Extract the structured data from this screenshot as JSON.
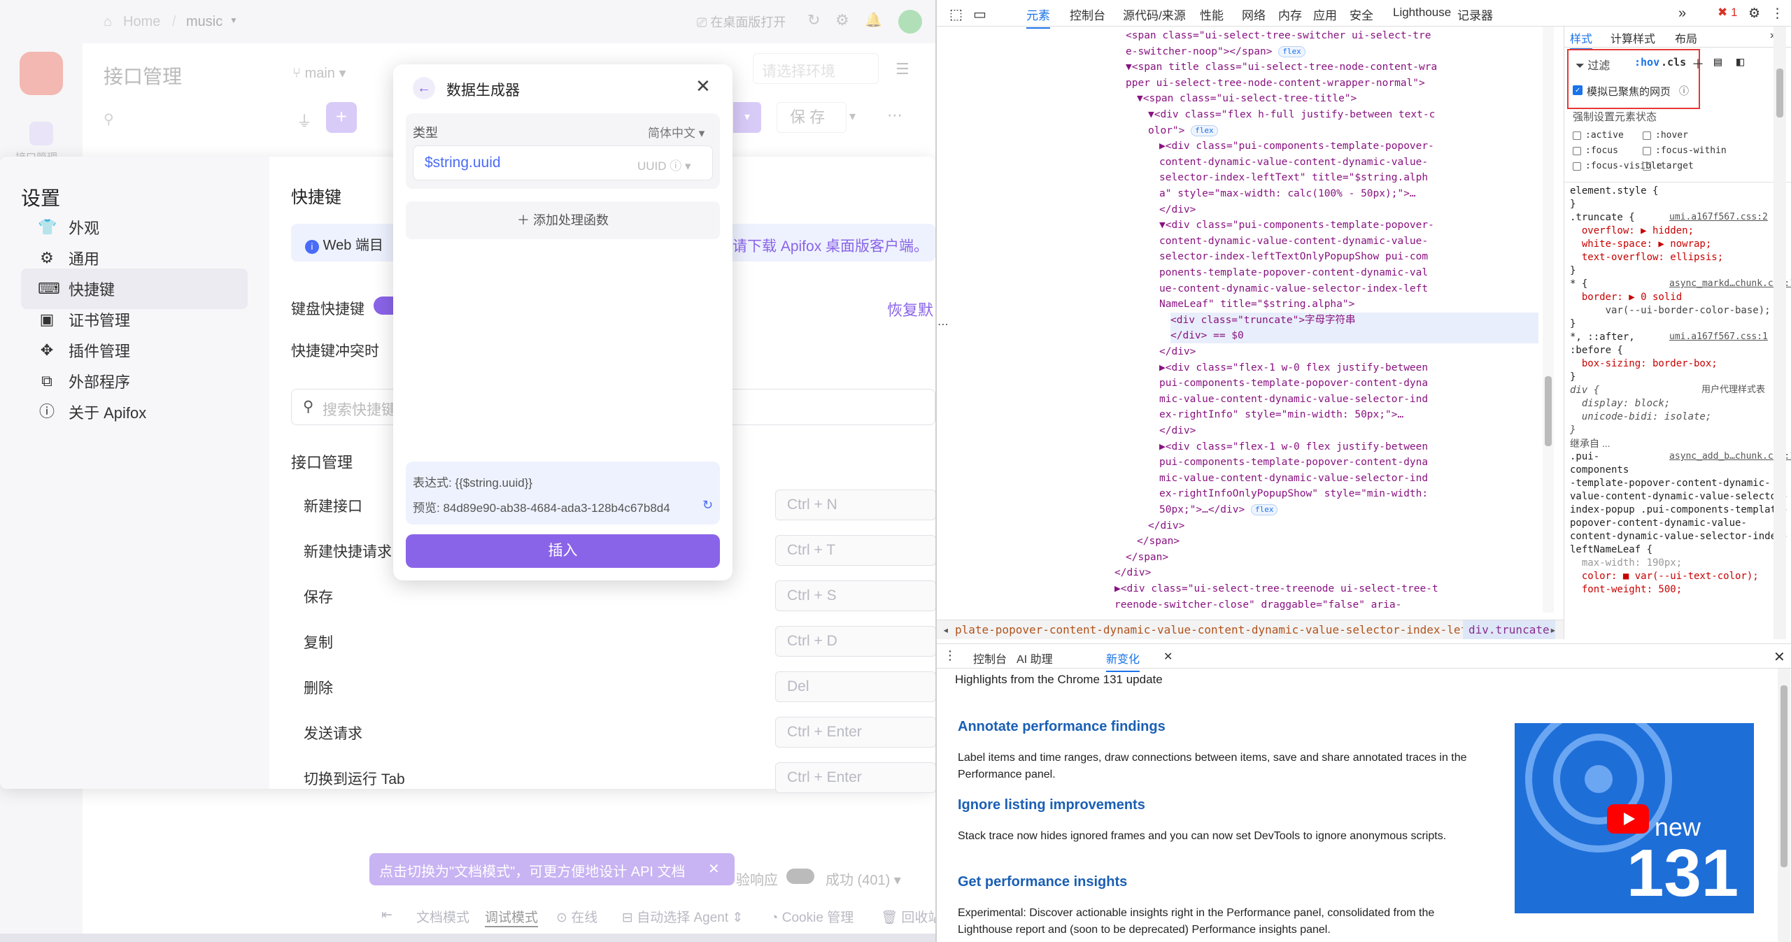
{
  "app": {
    "breadcrumb_home": "Home",
    "breadcrumb_project": "music",
    "open_web": "在桌面版打开",
    "page_title": "接口管理",
    "branch": "main",
    "env_placeholder": "请选择环境",
    "save_label": "保 存",
    "banner_text": "Web 端目",
    "banner_suffix": "请下载 Apifox 桌面版客户端。",
    "restore_label": "恢复默",
    "sidebar_label": "接口管理",
    "settings": {
      "title": "设置",
      "menu": [
        {
          "label": "外观",
          "icon": "shirt-icon"
        },
        {
          "label": "通用",
          "icon": "gear-icon"
        },
        {
          "label": "快捷键",
          "icon": "keyboard-icon"
        },
        {
          "label": "证书管理",
          "icon": "certificate-icon"
        },
        {
          "label": "插件管理",
          "icon": "plugin-icon"
        },
        {
          "label": "外部程序",
          "icon": "external-app-icon"
        },
        {
          "label": "关于 Apifox",
          "icon": "info-icon"
        }
      ],
      "section_title": "快捷键",
      "keyboard_shortcuts_label": "键盘快捷键",
      "conflict_label": "快捷键冲突时",
      "search_placeholder": "搜索快捷键",
      "group_title": "接口管理",
      "shortcuts": [
        {
          "label": "新建接口",
          "keys": "Ctrl + N"
        },
        {
          "label": "新建快捷请求",
          "keys": "Ctrl + T"
        },
        {
          "label": "保存",
          "keys": "Ctrl + S"
        },
        {
          "label": "复制",
          "keys": "Ctrl + D"
        },
        {
          "label": "删除",
          "keys": "Del"
        },
        {
          "label": "发送请求",
          "keys": "Ctrl + Enter"
        },
        {
          "label": "切换到运行 Tab",
          "keys": "Ctrl + Enter"
        }
      ]
    },
    "dialog": {
      "title": "数据生成器",
      "type_label": "类型",
      "lang_label": "简体中文",
      "type_value": "$string.uuid",
      "type_hint": "UUID",
      "add_function": "添加处理函数",
      "expression": "表达式: {{$string.uuid}}",
      "preview": "预览: 84d89e90-ab38-4684-ada3-128b4c67b8d4",
      "insert_label": "插入"
    },
    "toast": "点击切换为\"文档模式\"，可更方便地设计 API 文档",
    "validate_label": "验响应",
    "status_label": "成功 (401)",
    "bottom": {
      "doc_mode": "文档模式",
      "debug_mode": "调试模式",
      "online": "在线",
      "agent": "自动选择 Agent",
      "cookie": "Cookie 管理",
      "recycle": "回收站"
    }
  },
  "devtools": {
    "tabs": [
      "元素",
      "控制台",
      "源代码/来源",
      "性能",
      "网络",
      "内存",
      "应用",
      "安全",
      "Lighthouse",
      "记录器"
    ],
    "error_count": "1",
    "style_tabs": [
      "样式",
      "计算样式",
      "布局"
    ],
    "filter_placeholder": "过滤",
    "hov": ":hov",
    "cls": ".cls",
    "emulate_focus": "模拟已聚焦的网页",
    "force_state_title": "强制设置元素状态",
    "states": [
      ":active",
      ":hover",
      ":focus",
      ":focus-within",
      ":focus-visible",
      ":target"
    ],
    "crumb_path": "plate-popover-content-dynamic-value-content-dynamic-value-selector-index-leftNameLeaf",
    "crumb_active": "div.truncate",
    "drawer_tabs": [
      "控制台",
      "AI 助理",
      "新变化"
    ],
    "whatsnew": {
      "headline": "Highlights from the Chrome 131 update",
      "items": [
        {
          "title": "Annotate performance findings",
          "body": "Label items and time ranges, draw connections between items, save and share annotated traces in the Performance panel."
        },
        {
          "title": "Ignore listing improvements",
          "body": "Stack trace now hides ignored frames and you can now set DevTools to ignore anonymous scripts."
        },
        {
          "title": "Get performance insights",
          "body": "Experimental: Discover actionable insights right in the Performance panel, consolidated from the Lighthouse report and (soon to be deprecated) Performance insights panel."
        }
      ],
      "badge_new": "new",
      "badge_version": "131"
    },
    "code_lines": [
      {
        "t": "<span class=\"ui-select-tree-switcher ui-select-tre",
        "i": 0
      },
      {
        "t": "e-switcher-noop\"></span>",
        "i": 0,
        "pill": "flex"
      },
      {
        "t": "▼<span title class=\"ui-select-tree-node-content-wra",
        "i": 0
      },
      {
        "t": "pper ui-select-tree-node-content-wrapper-normal\">",
        "i": 0
      },
      {
        "t": "▼<span class=\"ui-select-tree-title\">",
        "i": 1
      },
      {
        "t": "▼<div class=\"flex h-full justify-between text-c",
        "i": 2
      },
      {
        "t": "olor\">",
        "i": 2,
        "pill": "flex"
      },
      {
        "t": "▶<div class=\"pui-components-template-popover-",
        "i": 3
      },
      {
        "t": "content-dynamic-value-content-dynamic-value-",
        "i": 3
      },
      {
        "t": "selector-index-leftText\" title=\"$string.alph",
        "i": 3
      },
      {
        "t": "a\" style=\"max-width: calc(100% - 50px);\">…",
        "i": 3
      },
      {
        "t": "</div>",
        "i": 3
      },
      {
        "t": "▼<div class=\"pui-components-template-popover-",
        "i": 3
      },
      {
        "t": "content-dynamic-value-content-dynamic-value-",
        "i": 3
      },
      {
        "t": "selector-index-leftTextOnlyPopupShow pui-com",
        "i": 3
      },
      {
        "t": "ponents-template-popover-content-dynamic-val",
        "i": 3
      },
      {
        "t": "ue-content-dynamic-value-selector-index-left",
        "i": 3
      },
      {
        "t": "NameLeaf\" title=\"$string.alpha\">",
        "i": 3
      },
      {
        "t": "<div class=\"truncate\">字母字符串",
        "i": 4,
        "sel": true
      },
      {
        "t": "</div> == $0",
        "i": 4,
        "sel": true
      },
      {
        "t": "</div>",
        "i": 3
      },
      {
        "t": "▶<div class=\"flex-1 w-0 flex justify-between",
        "i": 3
      },
      {
        "t": "pui-components-template-popover-content-dyna",
        "i": 3
      },
      {
        "t": "mic-value-content-dynamic-value-selector-ind",
        "i": 3
      },
      {
        "t": "ex-rightInfo\" style=\"min-width: 50px;\">…",
        "i": 3
      },
      {
        "t": "</div>",
        "i": 3
      },
      {
        "t": "▶<div class=\"flex-1 w-0 flex justify-between",
        "i": 3
      },
      {
        "t": "pui-components-template-popover-content-dyna",
        "i": 3
      },
      {
        "t": "mic-value-content-dynamic-value-selector-ind",
        "i": 3
      },
      {
        "t": "ex-rightInfoOnlyPopupShow\" style=\"min-width:",
        "i": 3
      },
      {
        "t": "50px;\">…</div>",
        "i": 3,
        "pill": "flex"
      },
      {
        "t": "</div>",
        "i": 2
      },
      {
        "t": "</span>",
        "i": 1
      },
      {
        "t": "</span>",
        "i": 0
      },
      {
        "t": "</div>",
        "i": -1
      },
      {
        "t": "▶<div class=\"ui-select-tree-treenode ui-select-tree-t",
        "i": -1
      },
      {
        "t": "reenode-switcher-close\" draggable=\"false\" aria-",
        "i": -1
      }
    ],
    "style_lines": [
      {
        "t": "element.style {",
        "c": "sel"
      },
      {
        "t": "}",
        "c": "sel"
      },
      {
        "t": ".truncate {",
        "c": "sel",
        "src": "umi.a167f567.css:2"
      },
      {
        "t": "  overflow: ▶ hidden;",
        "c": "prop"
      },
      {
        "t": "  white-space: ▶ nowrap;",
        "c": "prop"
      },
      {
        "t": "  text-overflow: ellipsis;",
        "c": "prop"
      },
      {
        "t": "}",
        "c": "sel"
      },
      {
        "t": "* {",
        "c": "sel",
        "src": "async_markd…chunk.css:1"
      },
      {
        "t": "  border: ▶ 0 solid",
        "c": "prop"
      },
      {
        "t": "      var(--ui-border-color-base);",
        "c": "val"
      },
      {
        "t": "}",
        "c": "sel"
      },
      {
        "t": "*, ::after,",
        "c": "sel",
        "src": "umi.a167f567.css:1"
      },
      {
        "t": ":before {",
        "c": "sel"
      },
      {
        "t": "  box-sizing: border-box;",
        "c": "prop"
      },
      {
        "t": "}",
        "c": "sel"
      },
      {
        "t": "div {",
        "c": "ua",
        "src": "用户代理样式表"
      },
      {
        "t": "  display: block;",
        "c": "ua"
      },
      {
        "t": "  unicode-bidi: isolate;",
        "c": "ua"
      },
      {
        "t": "}",
        "c": "ua"
      },
      {
        "t": "继承自 ...",
        "c": "head"
      },
      {
        "t": ".pui-",
        "c": "sel",
        "src": "async_add_b…chunk.css:1"
      },
      {
        "t": "components",
        "c": "sel"
      },
      {
        "t": "-template-popover-content-dynamic-",
        "c": "sel"
      },
      {
        "t": "value-content-dynamic-value-selector-",
        "c": "sel"
      },
      {
        "t": "index-popup .pui-components-template-",
        "c": "sel"
      },
      {
        "t": "popover-content-dynamic-value-",
        "c": "sel"
      },
      {
        "t": "content-dynamic-value-selector-index-",
        "c": "sel"
      },
      {
        "t": "leftNameLeaf {",
        "c": "sel"
      },
      {
        "t": "  max-width: 190px;",
        "c": "dim"
      },
      {
        "t": "  color: ■ var(--ui-text-color);",
        "c": "prop"
      },
      {
        "t": "  font-weight: 500;",
        "c": "prop"
      }
    ]
  }
}
